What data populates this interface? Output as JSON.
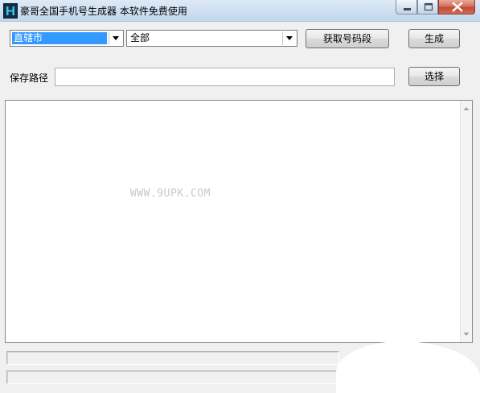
{
  "window": {
    "title": "豪哥全国手机号生成器  本软件免费使用",
    "controls": [
      "minimize-icon",
      "maximize-icon",
      "close-icon"
    ],
    "title_bar_color": "#cfe0f2",
    "close_color": "#c04b36"
  },
  "toolbar": {
    "city_select": {
      "value": "直辖市",
      "highlight_color": "#3399ff"
    },
    "district_select": {
      "value": "全部"
    },
    "fetch_button": "获取号码段",
    "generate_button": "生成"
  },
  "save": {
    "label": "保存路径",
    "path_value": "",
    "choose_button": "选择"
  },
  "output": {
    "text": "",
    "watermark": "WWW.9UPK.COM"
  },
  "statusbars": [
    "",
    ""
  ]
}
